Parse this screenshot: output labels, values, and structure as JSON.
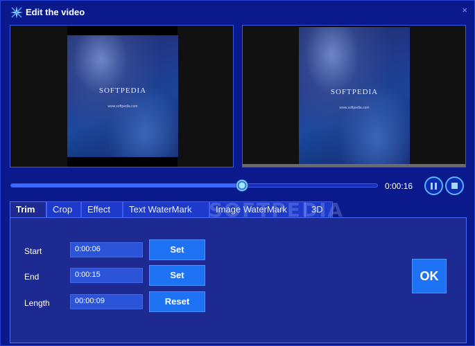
{
  "window": {
    "title": "Edit the video",
    "close_glyph": "×"
  },
  "preview": {
    "left": {
      "brand": "SOFTPEDIA",
      "url": "www.softpedia.com"
    },
    "right": {
      "brand": "SOFTPEDIA",
      "url": "www.softpedia.com"
    }
  },
  "player": {
    "time": "0:00:16",
    "seek_fraction": 0.63,
    "pause_label": "pause",
    "stop_label": "stop"
  },
  "tabs": [
    {
      "label": "Trim",
      "active": true
    },
    {
      "label": "Crop",
      "active": false
    },
    {
      "label": "Effect",
      "active": false
    },
    {
      "label": "Text WaterMark",
      "active": false
    },
    {
      "label": "Image WaterMark",
      "active": false
    },
    {
      "label": "3D",
      "active": false
    }
  ],
  "trim": {
    "start_label": "Start",
    "start_value": "0:00:06",
    "end_label": "End",
    "end_value": "0:00:15",
    "length_label": "Length",
    "length_value": "00:00:09",
    "set_label": "Set",
    "reset_label": "Reset"
  },
  "ok_label": "OK",
  "watermark_text": "SOFTPEDIA",
  "colors": {
    "background": "#0a1a8c",
    "panel": "#1d2a92",
    "button": "#1e72f4",
    "accent": "#58b7ff"
  },
  "icons": {
    "app": "sparkle-icon",
    "close": "close-icon",
    "pause": "pause-icon",
    "stop": "stop-icon"
  }
}
